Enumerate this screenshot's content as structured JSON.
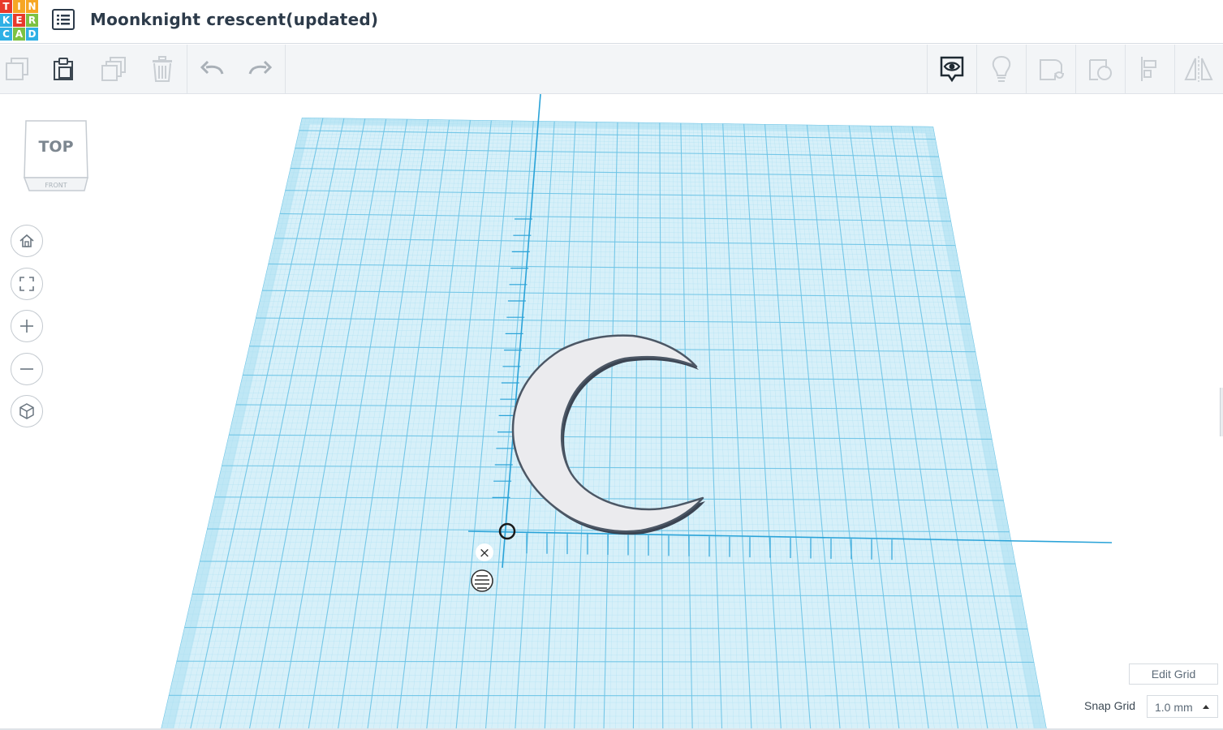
{
  "app": {
    "logo_letters": [
      "T",
      "I",
      "N",
      "K",
      "E",
      "R",
      "C",
      "A",
      "D"
    ],
    "logo_colors": [
      "#e8392b",
      "#f6a623",
      "#f6a623",
      "#2fb0e5",
      "#e8392b",
      "#7cc142",
      "#2fb0e5",
      "#7cc142",
      "#2fb0e5"
    ],
    "title": "Moonknight crescent(updated)",
    "menu_icon": "list-icon"
  },
  "toolbar": {
    "left": [
      {
        "name": "copy",
        "icon": "copy-icon",
        "enabled": false
      },
      {
        "name": "paste",
        "icon": "paste-icon",
        "enabled": true
      },
      {
        "name": "duplicate",
        "icon": "duplicate-icon",
        "enabled": false
      },
      {
        "name": "delete",
        "icon": "trash-icon",
        "enabled": false
      },
      {
        "name": "undo",
        "icon": "undo-icon",
        "enabled": true
      },
      {
        "name": "redo",
        "icon": "redo-icon",
        "enabled": true
      }
    ],
    "right": [
      {
        "name": "notes",
        "icon": "eye-speech-icon",
        "enabled": true
      },
      {
        "name": "show-all",
        "icon": "lightbulb-icon",
        "enabled": false
      },
      {
        "name": "group",
        "icon": "group-icon",
        "enabled": false
      },
      {
        "name": "ungroup",
        "icon": "ungroup-icon",
        "enabled": false
      },
      {
        "name": "align",
        "icon": "align-icon",
        "enabled": false
      },
      {
        "name": "mirror",
        "icon": "mirror-icon",
        "enabled": false
      }
    ]
  },
  "viewcube": {
    "top_label": "TOP",
    "front_label": "FRONT"
  },
  "nav": [
    "home-icon",
    "fit-view-icon",
    "zoom-in-icon",
    "zoom-out-icon",
    "perspective-icon"
  ],
  "workplane": {
    "grid_color": "#a8dff2",
    "object": "crescent",
    "object_fill": "#ebebee",
    "object_stroke": "#4c5765",
    "close_glyph": "×"
  },
  "bottom": {
    "edit_grid_label": "Edit Grid",
    "snap_label": "Snap Grid",
    "snap_value": "1.0 mm"
  }
}
